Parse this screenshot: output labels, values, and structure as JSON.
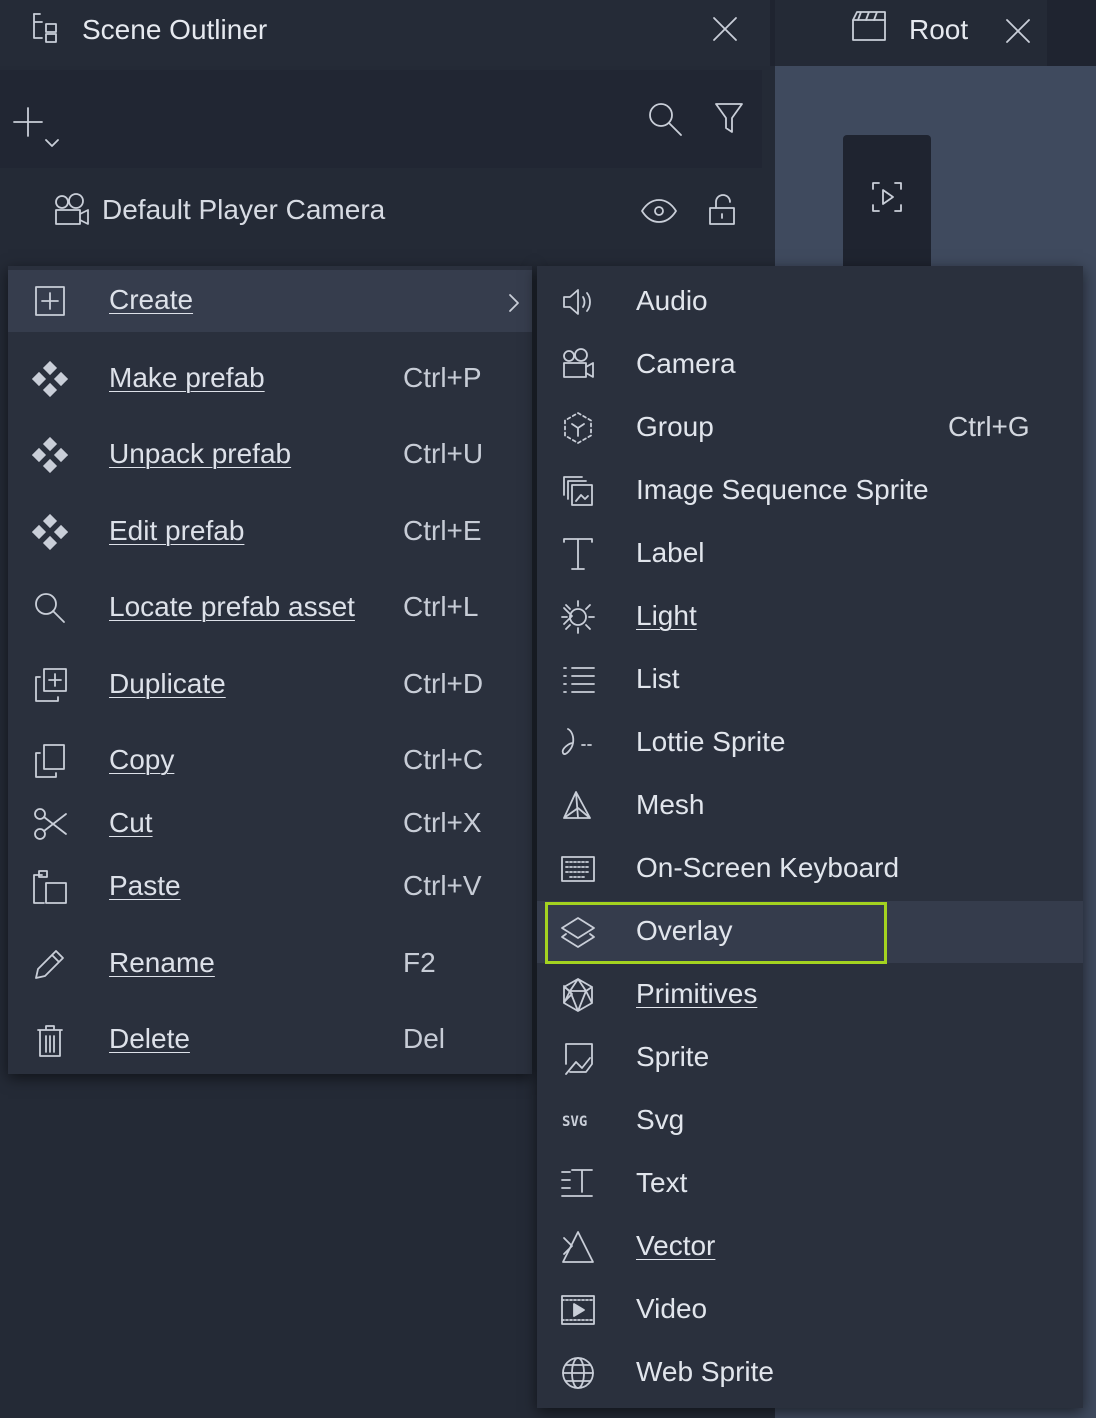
{
  "tabs": {
    "outliner_title": "Scene Outliner",
    "root_title": "Root"
  },
  "outliner": {
    "camera_row": "Default Player Camera"
  },
  "context_menu": {
    "items": [
      {
        "label": "Create",
        "shortcut": "",
        "icon": "plus-square-icon"
      },
      {
        "label": "Make prefab",
        "shortcut": "Ctrl+P",
        "icon": "prefab-icon"
      },
      {
        "label": "Unpack prefab",
        "shortcut": "Ctrl+U",
        "icon": "prefab-icon"
      },
      {
        "label": "Edit prefab",
        "shortcut": "Ctrl+E",
        "icon": "prefab-icon"
      },
      {
        "label": "Locate prefab asset",
        "shortcut": "Ctrl+L",
        "icon": "search-icon"
      },
      {
        "label": "Duplicate",
        "shortcut": "Ctrl+D",
        "icon": "duplicate-icon"
      },
      {
        "label": "Copy",
        "shortcut": "Ctrl+C",
        "icon": "copy-icon"
      },
      {
        "label": "Cut",
        "shortcut": "Ctrl+X",
        "icon": "scissors-icon"
      },
      {
        "label": "Paste",
        "shortcut": "Ctrl+V",
        "icon": "paste-icon"
      },
      {
        "label": "Rename",
        "shortcut": "F2",
        "icon": "pencil-icon"
      },
      {
        "label": "Delete",
        "shortcut": "Del",
        "icon": "trash-icon"
      }
    ]
  },
  "create_submenu": {
    "items": [
      {
        "label": "Audio",
        "shortcut": "",
        "icon": "speaker-icon"
      },
      {
        "label": "Camera",
        "shortcut": "",
        "icon": "camera-icon"
      },
      {
        "label": "Group",
        "shortcut": "Ctrl+G",
        "icon": "group-icon"
      },
      {
        "label": "Image Sequence Sprite",
        "shortcut": "",
        "icon": "image-sequence-icon"
      },
      {
        "label": "Label",
        "shortcut": "",
        "icon": "text-t-icon"
      },
      {
        "label": "Light",
        "shortcut": "",
        "icon": "sun-icon"
      },
      {
        "label": "List",
        "shortcut": "",
        "icon": "list-icon"
      },
      {
        "label": "Lottie Sprite",
        "shortcut": "",
        "icon": "lottie-icon"
      },
      {
        "label": "Mesh",
        "shortcut": "",
        "icon": "mesh-icon"
      },
      {
        "label": "On-Screen Keyboard",
        "shortcut": "",
        "icon": "keyboard-icon"
      },
      {
        "label": "Overlay",
        "shortcut": "",
        "icon": "layers-icon"
      },
      {
        "label": "Primitives",
        "shortcut": "",
        "icon": "icosahedron-icon"
      },
      {
        "label": "Sprite",
        "shortcut": "",
        "icon": "sprite-icon"
      },
      {
        "label": "Svg",
        "shortcut": "",
        "icon": "svg-icon"
      },
      {
        "label": "Text",
        "shortcut": "",
        "icon": "text-block-icon"
      },
      {
        "label": "Vector",
        "shortcut": "",
        "icon": "triangle-icon"
      },
      {
        "label": "Video",
        "shortcut": "",
        "icon": "video-icon"
      },
      {
        "label": "Web Sprite",
        "shortcut": "",
        "icon": "globe-icon"
      }
    ],
    "highlighted": "Overlay",
    "highlight_color": "#a3d320"
  }
}
